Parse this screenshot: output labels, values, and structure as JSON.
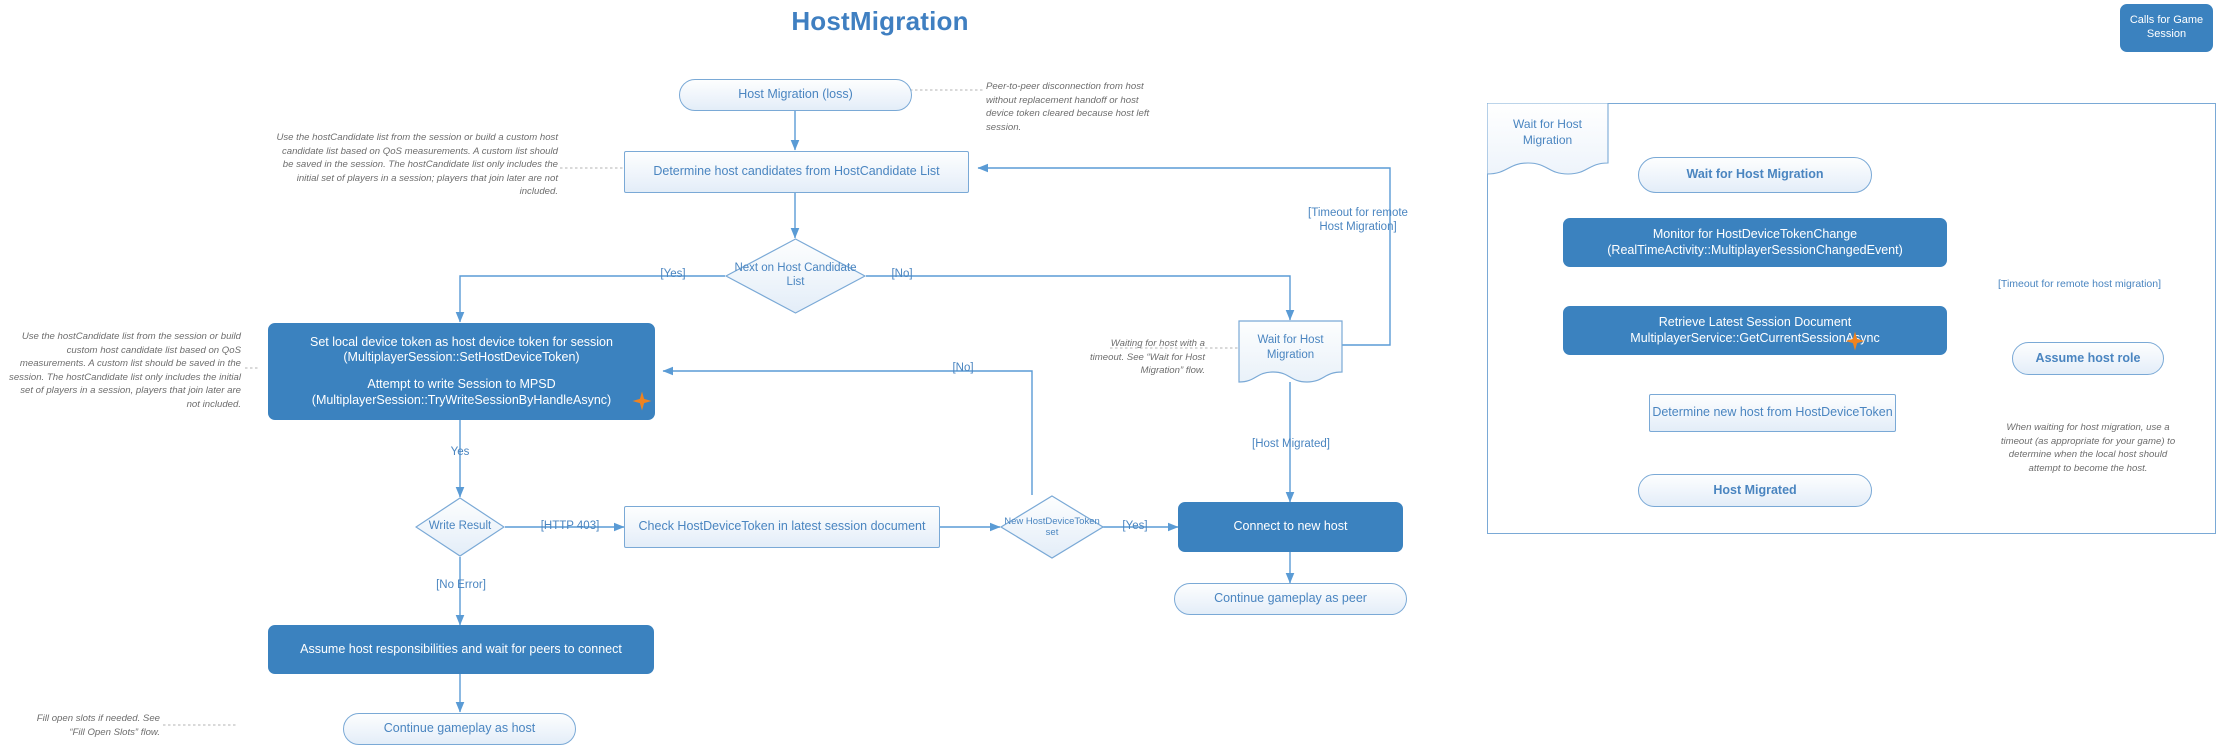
{
  "page": {
    "title": "HostMigration",
    "accent_blue": "#3f7fc1",
    "node_fill_solid": "#3b82bf",
    "node_border_light": "#7aa9d6",
    "note_color": "#6d6d6d",
    "star_color": "#ef8320"
  },
  "legend": {
    "label": "Calls for Game Session"
  },
  "main_flow": {
    "start": {
      "label": "Host Migration (loss)"
    },
    "determine_candidates": {
      "label": "Determine host candidates from HostCandidate List"
    },
    "next_on_list": {
      "label": "Next on Host Candidate List"
    },
    "set_token": {
      "line1": "Set local device token as host device token for session",
      "line2": "(MultiplayerSession::SetHostDeviceToken)",
      "line3": "Attempt to write Session to MPSD",
      "line4": "(MultiplayerSession::TryWriteSessionByHandleAsync)"
    },
    "write_result": {
      "label": "Write Result"
    },
    "check_token": {
      "label": "Check HostDeviceToken in latest session document"
    },
    "new_token_set": {
      "label": "New HostDeviceToken set"
    },
    "wait_for_host_migration": {
      "line1": "Wait for Host",
      "line2": "Migration"
    },
    "connect_new_host": {
      "label": "Connect to new host"
    },
    "continue_peer": {
      "label": "Continue gameplay as peer"
    },
    "assume_host": {
      "label": "Assume host responsibilities and wait for peers to connect"
    },
    "continue_host": {
      "label": "Continue gameplay as host"
    }
  },
  "main_edges": {
    "yes_bracket": "[Yes]",
    "no_bracket": "[No]",
    "yes_plain": "Yes",
    "http403": "[HTTP 403]",
    "no_error": "[No Error]",
    "no_bracket_mid": "[No]",
    "yes_bracket_2": "[Yes]",
    "host_migrated": "[Host Migrated]",
    "timeout_remote_l1": "[Timeout for remote",
    "timeout_remote_l2": "Host Migration]"
  },
  "main_notes": {
    "start_note": "Peer-to-peer disconnection from host without replacement handoff or host device token cleared because host left session.",
    "candidates_note": "Use the hostCandidate list from the session or build a custom host candidate list based on QoS measurements. A custom list should be saved in the session. The hostCandidate list only includes the initial set of players in a session; players that join later are not included.",
    "set_token_note": "Use the hostCandidate list from the session or build custom host candidate list based on QoS measurements. A custom list should be saved in the session. The hostCandidate list only includes the initial set of players in a session, players that join later are not included.",
    "wait_note": "Waiting for host with a timeout. See “Wait for Host Migration” flow.",
    "fill_slots_note": "Fill open slots if needed. See “Fill Open Slots” flow."
  },
  "subflow": {
    "frame_tab_l1": "Wait for Host",
    "frame_tab_l2": "Migration",
    "start": {
      "label": "Wait for Host Migration"
    },
    "monitor": {
      "line1": "Monitor for HostDeviceTokenChange",
      "line2": "(RealTimeActivity::MultiplayerSessionChangedEvent)"
    },
    "retrieve": {
      "line1": "Retrieve Latest Session Document",
      "line2": "MultiplayerService::GetCurrentSessionAsync"
    },
    "determine_new_host": {
      "label": "Determine new host from HostDeviceToken"
    },
    "host_migrated": {
      "label": "Host Migrated"
    },
    "assume_host_role": {
      "label": "Assume host role"
    },
    "timeout_label": "[Timeout for remote host migration]",
    "timeout_note": "When waiting for host migration, use a timeout (as appropriate for your game) to determine when the local host should attempt to become the host."
  }
}
